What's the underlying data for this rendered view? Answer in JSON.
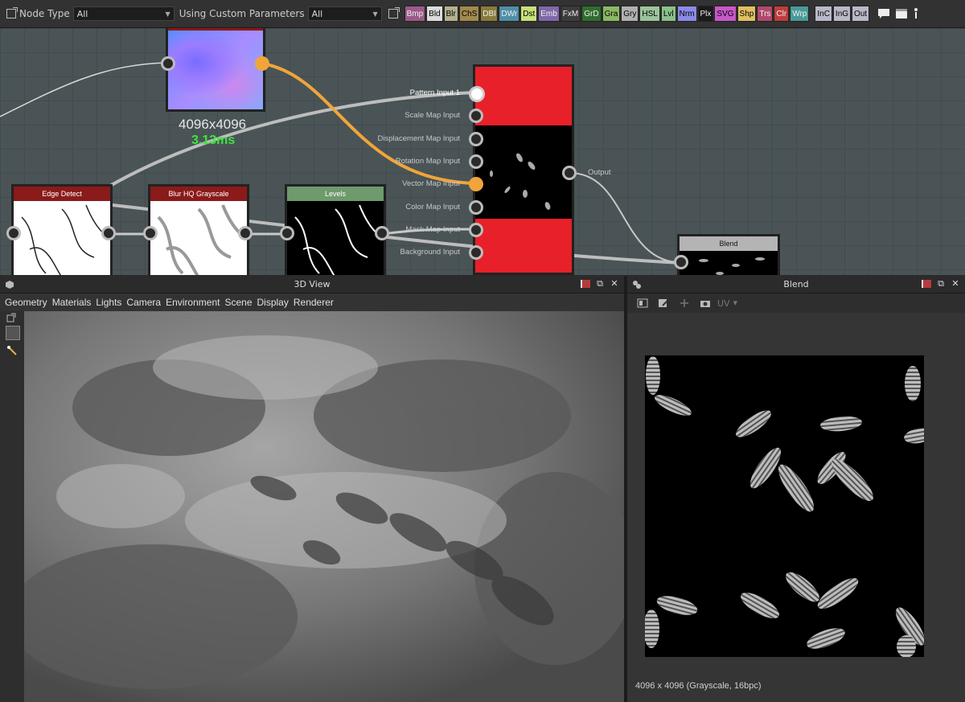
{
  "toolbar": {
    "node_type_label": "Node Type",
    "node_type_value": "All",
    "custom_params_label": "Using Custom Parameters",
    "custom_params_value": "All",
    "filters": [
      {
        "label": "Bmp",
        "color": "#9c5a8a"
      },
      {
        "label": "Bld",
        "color": "#dcdcdc"
      },
      {
        "label": "Blr",
        "color": "#b5b08e"
      },
      {
        "label": "ChS",
        "color": "#a38a4c"
      },
      {
        "label": "DBl",
        "color": "#8a7a3a"
      },
      {
        "label": "DWr",
        "color": "#4f8fa6"
      },
      {
        "label": "Dst",
        "color": "#c8e07a"
      },
      {
        "label": "Emb",
        "color": "#8068a8"
      },
      {
        "label": "FxM",
        "color": "#3c3c3c"
      },
      {
        "label": "GrD",
        "color": "#2f6d2f"
      },
      {
        "label": "Gra",
        "color": "#8ab864"
      },
      {
        "label": "Gry",
        "color": "#b0b0b0"
      },
      {
        "label": "HSL",
        "color": "#9cc49c"
      },
      {
        "label": "Lvl",
        "color": "#8ac08a"
      },
      {
        "label": "Nrm",
        "color": "#8a8ae8"
      },
      {
        "label": "Plx",
        "color": "#1a1a1a"
      },
      {
        "label": "SVG",
        "color": "#c858c8"
      },
      {
        "label": "Shp",
        "color": "#e0c060"
      },
      {
        "label": "Trs",
        "color": "#b04a6a"
      },
      {
        "label": "Clr",
        "color": "#c03c3c"
      },
      {
        "label": "Wrp",
        "color": "#4a9a9a"
      },
      {
        "label": "InC",
        "color": "#b8b8c8"
      },
      {
        "label": "InG",
        "color": "#b8b8c8"
      },
      {
        "label": "Out",
        "color": "#b8b8c8"
      }
    ]
  },
  "graph": {
    "normal_node": {
      "resolution": "4096x4096",
      "time": "3.13ms"
    },
    "edge_detect": {
      "title": "Edge Detect",
      "header_color": "#8b1a1a"
    },
    "blur": {
      "title": "Blur HQ Grayscale",
      "header_color": "#8b1a1a"
    },
    "levels": {
      "title": "Levels",
      "header_color": "#6e9a6e"
    },
    "blend_node": {
      "title": "Blend",
      "header_color": "#b4b4b4"
    },
    "tile_sampler": {
      "inputs": [
        "Pattern Input 1",
        "Scale Map Input",
        "Displacement Map Input",
        "Rotation Map Input",
        "Vector Map Input",
        "Color Map Input",
        "Mask Map Input",
        "Background Input"
      ],
      "output": "Output"
    }
  },
  "view3d": {
    "title": "3D View",
    "menu": [
      "Geometry",
      "Materials",
      "Lights",
      "Camera",
      "Environment",
      "Scene",
      "Display",
      "Renderer"
    ]
  },
  "blend_panel": {
    "title": "Blend",
    "uv_label": "UV",
    "status": "4096 x 4096 (Grayscale, 16bpc)"
  }
}
